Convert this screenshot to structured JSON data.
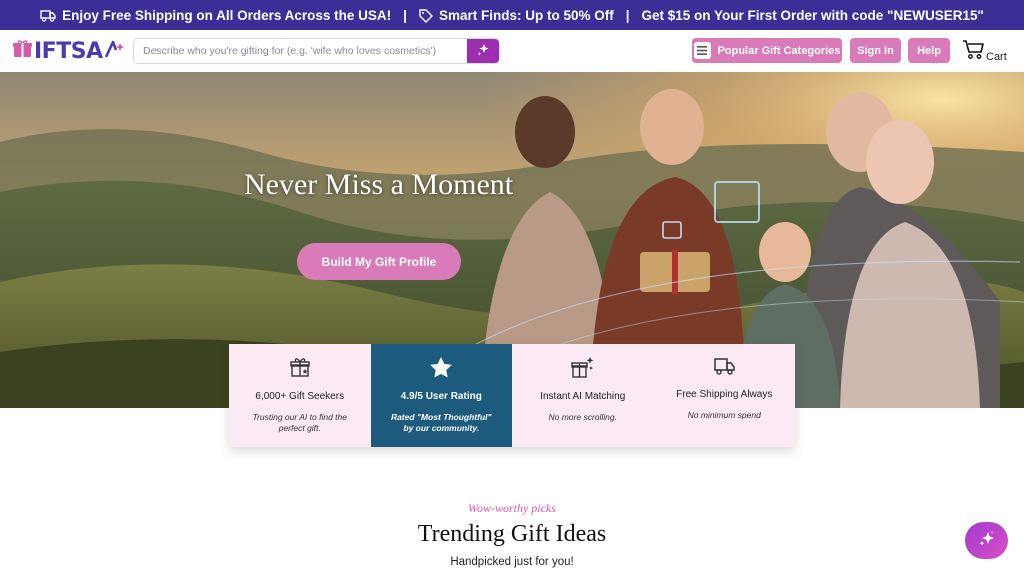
{
  "promo": {
    "item1": "Enjoy Free Shipping on All Orders Across the USA!",
    "sep": "|",
    "item2": "Smart Finds: Up to 50% Off",
    "item3": "Get $15 on Your First Order with code \"NEWUSER15\""
  },
  "header": {
    "logo_text_pink": "G",
    "logo_text": "IFTSA",
    "search_placeholder": "Describe who you're gifting for (e.g. 'wife who loves cosmetics')",
    "categories_label": "Popular Gift Categories",
    "signin_label": "Sign In",
    "help_label": "Help",
    "cart_label": "Cart"
  },
  "hero": {
    "title": "Never Miss a Moment",
    "cta_label": "Build My Gift Profile"
  },
  "stats": [
    {
      "icon": "gift-star-icon",
      "title": "6,000+ Gift Seekers",
      "sub": "Trusting our AI to find the perfect gift."
    },
    {
      "icon": "star-icon",
      "title": "4.9/5 User Rating",
      "sub": "Rated \"Most Thoughtful\" by our community."
    },
    {
      "icon": "ai-gift-icon",
      "title": "Instant AI Matching",
      "sub": "No more scrolling."
    },
    {
      "icon": "truck-icon",
      "title": "Free Shipping Always",
      "sub": "No minimum spend"
    }
  ],
  "trending": {
    "kicker": "Wow-worthy picks",
    "title": "Trending Gift Ideas",
    "sub": "Handpicked just for you!"
  },
  "colors": {
    "promo_bg": "#3b2f97",
    "accent_pink": "#d97bb8",
    "search_button": "#9b2fb0",
    "stat_dark": "#1c5a7e",
    "stat_light": "#fbeaf3"
  }
}
